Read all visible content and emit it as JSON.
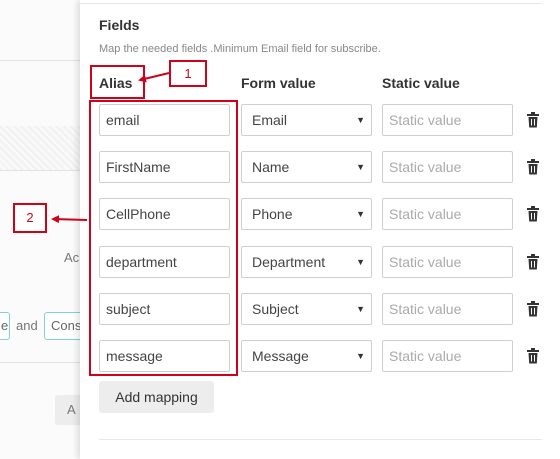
{
  "background": {
    "partial_text_1": "Ac",
    "tag_left": "e",
    "connector": "and",
    "tag_right": "Cons",
    "button_text": "A"
  },
  "fields": {
    "title": "Fields",
    "description": "Map the needed fields .Minimum Email field for subscribe.",
    "columns": {
      "alias": "Alias",
      "form_value": "Form value",
      "static_value": "Static value"
    },
    "rows": [
      {
        "alias": "email",
        "form_value": "Email",
        "static_placeholder": "Static value"
      },
      {
        "alias": "FirstName",
        "form_value": "Name",
        "static_placeholder": "Static value"
      },
      {
        "alias": "CellPhone",
        "form_value": "Phone",
        "static_placeholder": "Static value"
      },
      {
        "alias": "department",
        "form_value": "Department",
        "static_placeholder": "Static value"
      },
      {
        "alias": "subject",
        "form_value": "Subject",
        "static_placeholder": "Static value"
      },
      {
        "alias": "message",
        "form_value": "Message",
        "static_placeholder": "Static value"
      }
    ],
    "add_mapping_label": "Add mapping",
    "caret_glyph": "▼",
    "delete_icon": "trash-icon"
  },
  "annotations": {
    "label_1": "1",
    "label_2": "2",
    "color": "#d0021b"
  }
}
